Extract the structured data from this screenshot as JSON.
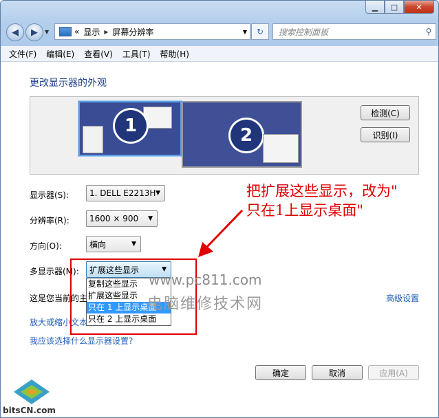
{
  "window": {
    "minimize_icon": "minimize-icon",
    "maximize_icon": "maximize-icon",
    "close_icon": "close-icon"
  },
  "nav": {
    "back_icon": "◀",
    "forward_icon": "▶",
    "path_prefix": "«",
    "breadcrumb": [
      "显示",
      "屏幕分辨率"
    ],
    "search_placeholder": "搜索控制面板"
  },
  "menu": [
    "文件(F)",
    "编辑(E)",
    "查看(V)",
    "工具(T)",
    "帮助(H)"
  ],
  "heading": "更改显示器的外观",
  "monitors": [
    {
      "number": "1"
    },
    {
      "number": "2"
    }
  ],
  "buttons": {
    "detect": "检测(C)",
    "identify": "识别(I)",
    "ok": "确定",
    "cancel": "取消",
    "apply": "应用(A)"
  },
  "fields": {
    "display": {
      "label": "显示器(S):",
      "value": "1. DELL E2213H"
    },
    "resolution": {
      "label": "分辨率(R):",
      "value": "1600 × 900"
    },
    "orientation": {
      "label": "方向(O):",
      "value": "横向"
    },
    "multi": {
      "label": "多显示器(M):",
      "value": "扩展这些显示"
    }
  },
  "multi_options": [
    "复制这些显示",
    "扩展这些显示",
    "只在 1 上显示桌面",
    "只在 2 上显示桌面"
  ],
  "multi_selected_index": 2,
  "current_line": "这是您当前的主",
  "advanced_link": "高级设置",
  "text_size_link": "放大或缩小文本",
  "help_link": "我应该选择什么显示器设置?",
  "annotation": [
    "把扩展这些显示，改为\"",
    "只在1上显示桌面\""
  ],
  "watermark": {
    "url": "www.pc811.com",
    "name": "电脑维修技术网"
  },
  "logo_text": "bitsCN.com",
  "colors": {
    "annotation": "#e00000",
    "selection": "#3399ff",
    "link": "#1f5fb8"
  }
}
